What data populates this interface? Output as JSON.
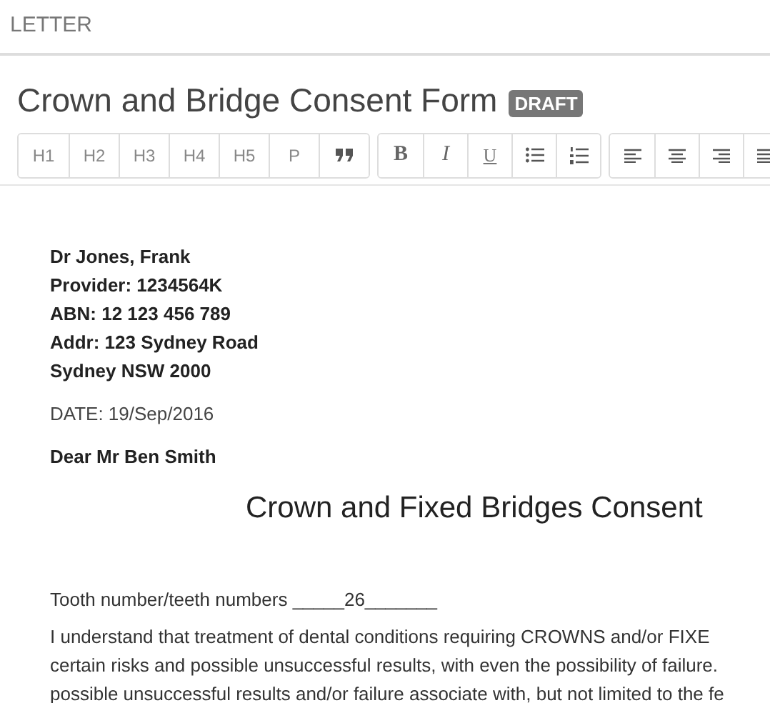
{
  "section_label": "LETTER",
  "title": "Crown and Bridge Consent Form",
  "badge": "DRAFT",
  "toolbar": [
    [
      {
        "kind": "text",
        "label": "H1"
      },
      {
        "kind": "text",
        "label": "H2"
      },
      {
        "kind": "text",
        "label": "H3"
      },
      {
        "kind": "text",
        "label": "H4"
      },
      {
        "kind": "text",
        "label": "H5"
      },
      {
        "kind": "text",
        "label": "P"
      },
      {
        "kind": "quote"
      }
    ],
    [
      {
        "kind": "bold",
        "label": "B"
      },
      {
        "kind": "italic",
        "label": "I"
      },
      {
        "kind": "underline",
        "label": "U"
      },
      {
        "kind": "bullets"
      },
      {
        "kind": "numbers"
      }
    ],
    [
      {
        "kind": "align-left"
      },
      {
        "kind": "align-center"
      },
      {
        "kind": "align-right"
      },
      {
        "kind": "justify"
      }
    ]
  ],
  "letter": {
    "sender_lines": [
      "Dr Jones, Frank",
      "Provider: 1234564K",
      "ABN: 12 123 456 789",
      "Addr: 123 Sydney Road",
      "Sydney NSW 2000"
    ],
    "date": "DATE: 19/Sep/2016",
    "salutation": "Dear Mr Ben Smith",
    "heading": "Crown and Fixed Bridges Consent",
    "tooth_line": "Tooth number/teeth numbers _____26_______",
    "paragraph_lines": [
      "I understand that treatment of dental conditions requiring CROWNS and/or FIXE",
      "certain risks and possible unsuccessful results, with even the possibility of failure.",
      "possible unsuccessful results and/or failure associate with, but not limited to the fe"
    ]
  }
}
